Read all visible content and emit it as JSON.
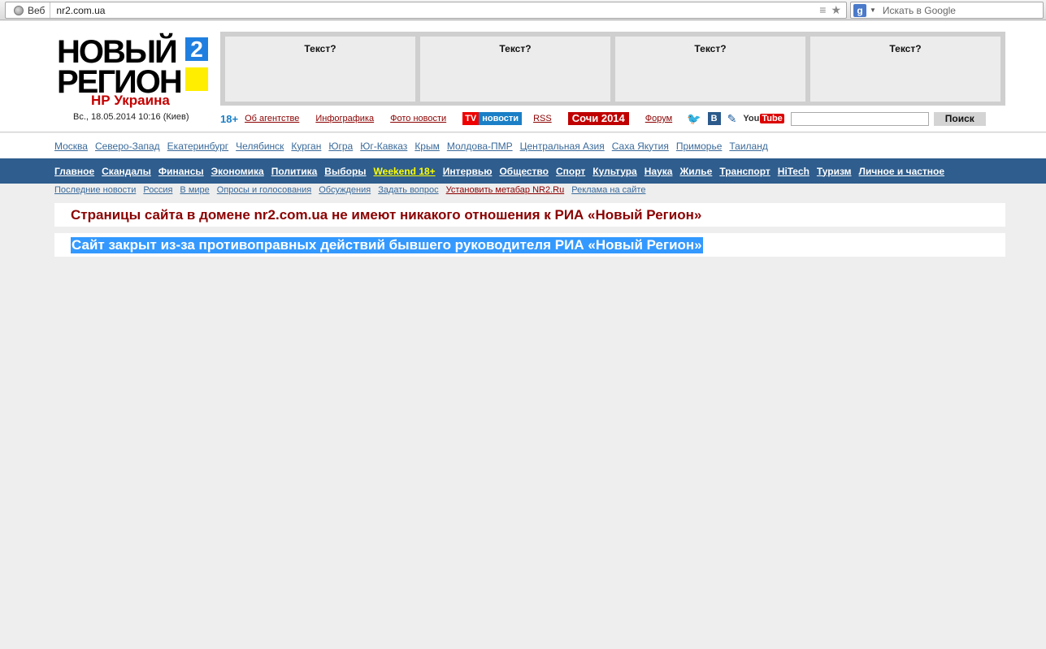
{
  "browser": {
    "web_chip": "Веб",
    "url": "nr2.com.ua",
    "search_placeholder": "Искать в Google"
  },
  "logo": {
    "line1": "НОВЫЙ",
    "line2": "РЕГИОН",
    "badge": "2",
    "subtitle": "НР Украина",
    "date": "Вс., 18.05.2014 10:16 (Киев)"
  },
  "ads": [
    "Текст?",
    "Текст?",
    "Текст?",
    "Текст?"
  ],
  "toolbar": {
    "age": "18+",
    "about": "Об агентстве",
    "infographics": "Инфографика",
    "photo_news": "Фото новости",
    "tv_prefix": "TV",
    "tv_label": "новости",
    "rss": "RSS",
    "sochi": "Сочи 2014",
    "forum": "Форум",
    "vk": "В",
    "yt_you": "You",
    "yt_tube": "Tube",
    "search_button": "Поиск"
  },
  "regions": [
    "Москва",
    "Северо-Запад",
    "Екатеринбург",
    "Челябинск",
    "Курган",
    "Югра",
    "Юг-Кавказ",
    "Крым",
    "Молдова-ПМР",
    "Центральная Азия",
    "Саха Якутия",
    "Приморье",
    "Таиланд"
  ],
  "mainnav": [
    "Главное",
    "Скандалы",
    "Финансы",
    "Экономика",
    "Политика",
    "Выборы",
    "Weekend 18+",
    "Интервью",
    "Общество",
    "Спорт",
    "Культура",
    "Наука",
    "Жилье",
    "Транспорт",
    "HiTech",
    "Туризм",
    "Личное и частное"
  ],
  "subnav": [
    "Последние новости",
    "Россия",
    "В мире",
    "Опросы и голосования",
    "Обсуждения",
    "Задать вопрос",
    "Установить метабар NR2.Ru",
    "Реклама на сайте"
  ],
  "notices": {
    "first": "Страницы сайта в домене nr2.com.ua не имеют никакого отношения к РИА «Новый Регион»",
    "second": "Сайт закрыт из-за противоправных действий бывшего руководителя РИА «Новый Регион»"
  },
  "colors": {
    "nav_bg": "#2e5d8e",
    "notice_red": "#8b0000",
    "selection": "#3399ff",
    "highlight_yellow": "#ffff00"
  }
}
